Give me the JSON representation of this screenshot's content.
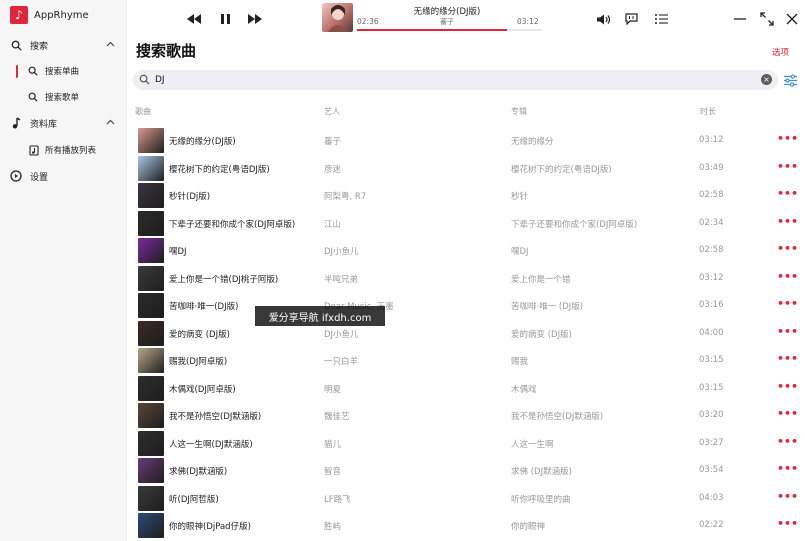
{
  "app": {
    "title": "AppRhyme"
  },
  "sidebar": {
    "items": [
      {
        "label": "搜索",
        "icon": "search-icon"
      },
      {
        "label": "搜索单曲",
        "icon": "search-icon",
        "active": true
      },
      {
        "label": "搜索歌单",
        "icon": "search-icon"
      },
      {
        "label": "资料库",
        "icon": "music-note-icon"
      },
      {
        "label": "所有播放列表",
        "icon": "playlist-icon"
      },
      {
        "label": "设置",
        "icon": "settings-icon"
      }
    ]
  },
  "player": {
    "title": "无缘的缘分(DJ版)",
    "artist": "蕃子",
    "current_time": "02:36",
    "total_time": "03:12",
    "progress": 0.81
  },
  "main": {
    "title": "搜索歌曲",
    "options_label": "选项",
    "search_query": "DJ",
    "columns": {
      "song": "歌曲",
      "artist": "艺人",
      "album": "专辑",
      "duration": "时长"
    }
  },
  "songs": [
    {
      "title": "无缘的缘分(DJ版)",
      "artist": "蕃子",
      "album": "无缘的缘分",
      "duration": "03:12",
      "cover": "#d99a8f"
    },
    {
      "title": "樱花树下的约定(粤语DJ版)",
      "artist": "彦迷",
      "album": "樱花树下的约定(粤语DJ版)",
      "duration": "03:49",
      "cover": "#a9c6e6"
    },
    {
      "title": "秒针(Dj版)",
      "artist": "阿梨粤, R7",
      "album": "秒针",
      "duration": "02:58",
      "cover": "#3a3440"
    },
    {
      "title": "下辈子还要和你成个家(DJ阿卓版)",
      "artist": "江山",
      "album": "下辈子还要和你成个家(DJ阿卓版)",
      "duration": "02:34",
      "cover": "#2b2b2b"
    },
    {
      "title": "嘿DJ",
      "artist": "DJ小鱼儿",
      "album": "嘿DJ",
      "duration": "02:58",
      "cover": "#7a2a9e"
    },
    {
      "title": "爱上你是一个错(DJ桃子阿版)",
      "artist": "半吨兄弟",
      "album": "爱上你是一个错",
      "duration": "03:12",
      "cover": "#3b3b3b"
    },
    {
      "title": "苦咖啡·唯一(DJ版)",
      "artist": "Dear Music, 玉墨",
      "album": "苦咖啡·唯一 (DJ版)",
      "duration": "03:16",
      "cover": "#2a2a2a"
    },
    {
      "title": "爱的病变 (DJ版)",
      "artist": "DJ小鱼儿",
      "album": "爱的病变 (DJ版)",
      "duration": "04:00",
      "cover": "#3a2a25"
    },
    {
      "title": "赐我(DJ阿卓版)",
      "artist": "一只白羊",
      "album": "赐我",
      "duration": "03:15",
      "cover": "#b8a88a"
    },
    {
      "title": "木偶戏(DJ阿卓版)",
      "artist": "明夏",
      "album": "木偶戏",
      "duration": "03:15",
      "cover": "#2d2d2d"
    },
    {
      "title": "我不是孙悟空(DJ默涵版)",
      "artist": "魏佳艺",
      "album": "我不是孙悟空(DJ默涵版)",
      "duration": "03:20",
      "cover": "#5a4536"
    },
    {
      "title": "人这一生啊(DJ默涵版)",
      "artist": "猫儿",
      "album": "人这一生啊",
      "duration": "03:27",
      "cover": "#2e2e2e"
    },
    {
      "title": "求佛(DJ默涵版)",
      "artist": "智音",
      "album": "求佛 (DJ默涵版)",
      "duration": "03:54",
      "cover": "#6b3a7a"
    },
    {
      "title": "听(DJ阿哲版)",
      "artist": "LF路飞",
      "album": "听你呼吸里的曲",
      "duration": "04:03",
      "cover": "#3a3a3a"
    },
    {
      "title": "你的眼神(DjPad仔版)",
      "artist": "胜屿",
      "album": "你的眼神",
      "duration": "02:22",
      "cover": "#2c4a78"
    }
  ],
  "watermark": "爱分享导航 ifxdh.com"
}
